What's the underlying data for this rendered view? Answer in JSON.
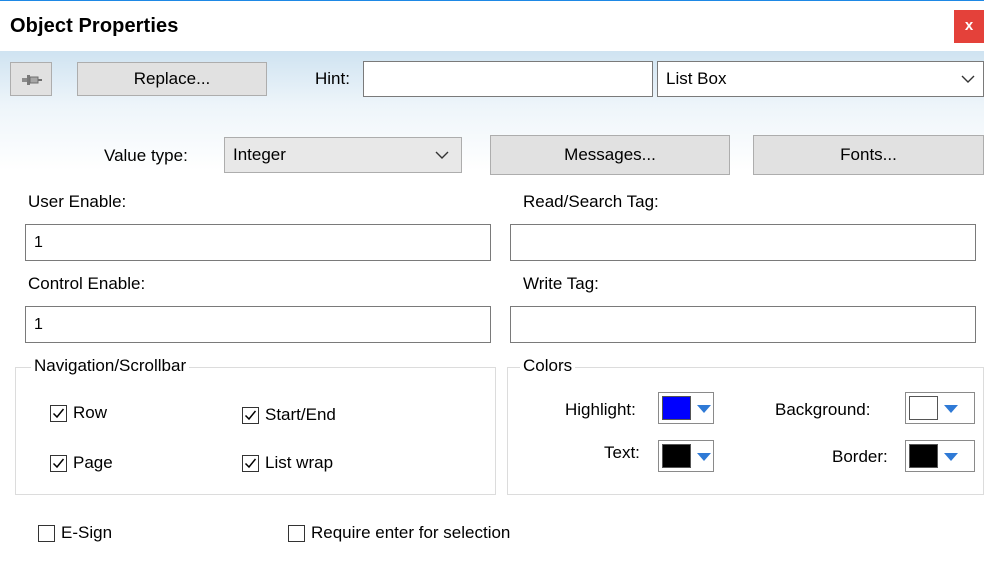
{
  "window": {
    "title": "Object Properties",
    "close_glyph": "x"
  },
  "toolbar": {
    "pin_icon": "pushpin-icon",
    "replace_label": "Replace...",
    "hint_label": "Hint:",
    "hint_value": "",
    "object_type": "List Box"
  },
  "row2": {
    "value_type_label": "Value type:",
    "value_type": "Integer",
    "messages_label": "Messages...",
    "fonts_label": "Fonts..."
  },
  "fields": {
    "user_enable_label": "User Enable:",
    "user_enable_value": "1",
    "read_search_tag_label": "Read/Search Tag:",
    "read_search_tag_value": "",
    "control_enable_label": "Control Enable:",
    "control_enable_value": "1",
    "write_tag_label": "Write Tag:",
    "write_tag_value": ""
  },
  "navigation": {
    "title": "Navigation/Scrollbar",
    "row": {
      "label": "Row",
      "checked": true
    },
    "start_end": {
      "label": "Start/End",
      "checked": true
    },
    "page": {
      "label": "Page",
      "checked": true
    },
    "list_wrap": {
      "label": "List wrap",
      "checked": true
    }
  },
  "colors": {
    "title": "Colors",
    "highlight": {
      "label": "Highlight:",
      "color": "#0000ff"
    },
    "background": {
      "label": "Background:",
      "color": "#ffffff"
    },
    "text": {
      "label": "Text:",
      "color": "#000000"
    },
    "border": {
      "label": "Border:",
      "color": "#000000"
    },
    "arrow_color": "#2f7ad6"
  },
  "bottom": {
    "e_sign": {
      "label": "E-Sign",
      "checked": false
    },
    "require_enter": {
      "label": "Require enter for selection",
      "checked": false
    }
  }
}
